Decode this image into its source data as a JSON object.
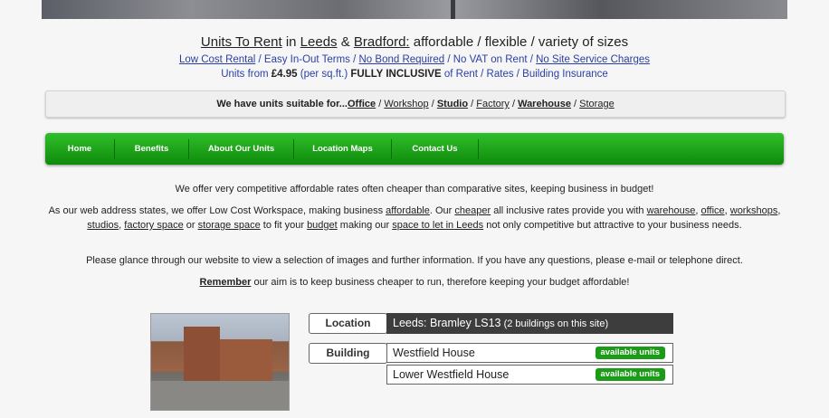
{
  "header": {
    "line1": {
      "units_to_rent": "Units To Rent",
      "in": " in ",
      "leeds": "Leeds",
      "amp": " & ",
      "bradford": "Bradford:",
      "rest": " affordable / flexible / variety of sizes"
    },
    "line2": {
      "low_cost": "Low Cost Rental",
      "sep1": " / Easy In-Out Terms / ",
      "no_bond": "No Bond Required",
      "sep2": " / No VAT on Rent / ",
      "no_site": "No Site Service Charges"
    },
    "line3": {
      "units_from": "Units from ",
      "price": "£4.95",
      "per": " (per sq.ft.) ",
      "fully": "FULLY INCLUSIVE",
      "rest": " of Rent / Rates / Building Insurance"
    }
  },
  "suitable": {
    "intro": "We have units suitable for...",
    "office": "Office",
    "workshop": "Workshop",
    "studio": "Studio",
    "factory": "Factory",
    "warehouse": "Warehouse",
    "storage": "Storage",
    "sep": " / "
  },
  "nav": {
    "items": [
      {
        "label": "Home"
      },
      {
        "label": "Benefits"
      },
      {
        "label": "About Our Units"
      },
      {
        "label": "Location Maps"
      },
      {
        "label": "Contact Us"
      }
    ]
  },
  "content": {
    "p1": "We offer very competitive affordable rates often cheaper than comparative sites, keeping business in budget!",
    "p2": {
      "a": "As our web address states, we offer Low Cost Workspace, making business ",
      "affordable": "affordable",
      "b": ".  Our ",
      "cheaper": "cheaper",
      "c": " all inclusive rates provide you with ",
      "warehouse": "warehouse",
      "d": ", ",
      "office": "office",
      "e": ", ",
      "workshops": "workshops",
      "f": ", ",
      "studios": "studios",
      "g": ", ",
      "factory_space": "factory space",
      "h": " or ",
      "storage_space": "storage space",
      "i": " to fit your ",
      "budget": "budget",
      "j": " making our ",
      "space_to_let": "space to let in Leeds",
      "k": " not only competitive but attractive to your business needs."
    },
    "p3": "Please glance through our website to view a selection of images and further information.  If you have any questions, please e-mail or telephone direct.",
    "p4": {
      "remember": "Remember",
      "rest": " our aim is to keep business cheaper to run, therefore keeping your budget affordable!"
    }
  },
  "listing": {
    "location_label": "Location",
    "location_value": "Leeds: Bramley LS13",
    "location_note": " (2 buildings on this site)",
    "building_label": "Building",
    "buildings": [
      {
        "name": "Westfield House",
        "badge": "available units"
      },
      {
        "name": "Lower Westfield House",
        "badge": "available units"
      }
    ]
  }
}
